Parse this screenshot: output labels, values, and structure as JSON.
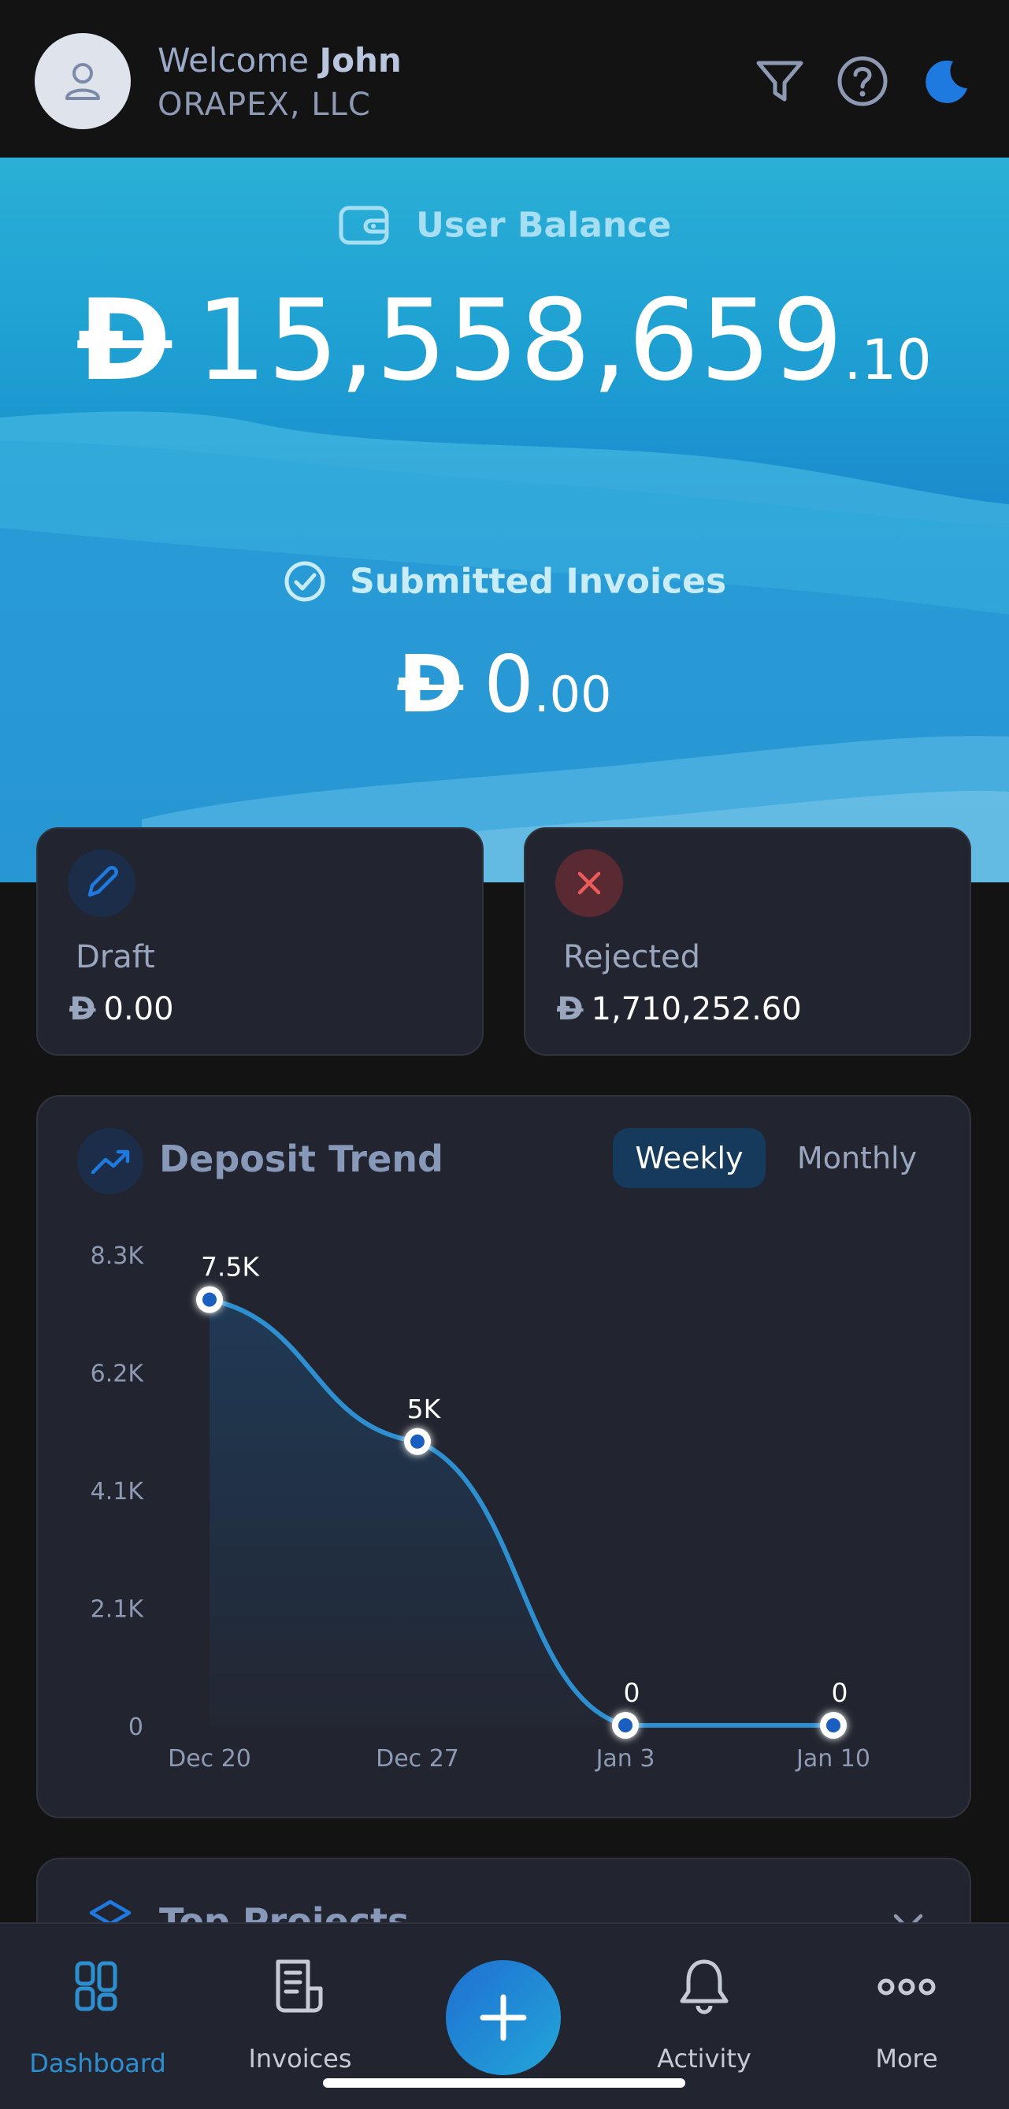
{
  "header": {
    "welcome_prefix": "Welcome",
    "user_name": "John",
    "company": "ORAPEX, LLC",
    "icons": [
      "filter-icon",
      "help-icon",
      "dark-mode-icon"
    ]
  },
  "balance": {
    "label": "User Balance",
    "currency_symbol": "Đ",
    "amount_main": "15,558,659",
    "amount_decimal": ".10"
  },
  "submitted": {
    "label": "Submitted Invoices",
    "currency_symbol": "Đ",
    "amount_main": "0",
    "amount_decimal": ".00"
  },
  "cards": {
    "draft": {
      "label": "Draft",
      "value": "0.00",
      "icon": "pencil-icon"
    },
    "rejected": {
      "label": "Rejected",
      "value": "1,710,252.60",
      "icon": "close-icon"
    }
  },
  "trend": {
    "title": "Deposit Trend",
    "tabs": {
      "weekly": "Weekly",
      "monthly": "Monthly"
    }
  },
  "chart_data": {
    "type": "line",
    "categories": [
      "Dec 20",
      "Dec 27",
      "Jan 3",
      "Jan 10"
    ],
    "values": [
      7500,
      5000,
      0,
      0
    ],
    "data_labels": [
      "7.5K",
      "5K",
      "0",
      "0"
    ],
    "y_ticks": [
      "0",
      "2.1K",
      "4.1K",
      "6.2K",
      "8.3K"
    ],
    "ylim": [
      0,
      8300
    ],
    "title": "Deposit Trend",
    "grid": false,
    "line_color": "#2d8fd0",
    "point_fill": "#1a5ec0"
  },
  "top_projects": {
    "title": "Top Projects"
  },
  "nav": {
    "dashboard": "Dashboard",
    "invoices": "Invoices",
    "activity": "Activity",
    "more": "More",
    "active_color": "#2d8fd0"
  },
  "colors": {
    "accent": "#1f7ae0",
    "danger": "#e04a4a",
    "card_bg": "#22252f"
  }
}
